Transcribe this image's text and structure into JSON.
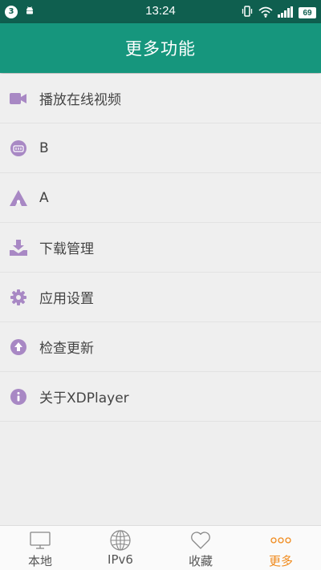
{
  "status_bar": {
    "notification_count": "3",
    "time": "13:24",
    "battery": "69",
    "icons": [
      "android-icon",
      "vibrate-icon",
      "wifi-icon",
      "signal-icon",
      "battery-icon"
    ]
  },
  "header": {
    "title": "更多功能"
  },
  "colors": {
    "accent": "#16967d",
    "status_bar": "#0f5f4f",
    "icon": "#a888c4",
    "active_tab": "#f08a1c"
  },
  "menu": {
    "items": [
      {
        "label": "播放在线视频",
        "icon": "video-camera-icon"
      },
      {
        "label": "B",
        "icon": "bilibili-icon"
      },
      {
        "label": "A",
        "icon": "acfun-icon"
      },
      {
        "label": "下载管理",
        "icon": "download-icon"
      },
      {
        "label": "应用设置",
        "icon": "gear-icon"
      },
      {
        "label": "检查更新",
        "icon": "upgrade-arrow-icon"
      },
      {
        "label": "关于XDPlayer",
        "icon": "info-icon"
      }
    ]
  },
  "bottom_nav": {
    "tabs": [
      {
        "label": "本地",
        "icon": "monitor-icon",
        "active": false
      },
      {
        "label": "IPv6",
        "icon": "globe-icon",
        "active": false
      },
      {
        "label": "收藏",
        "icon": "heart-icon",
        "active": false
      },
      {
        "label": "更多",
        "icon": "more-dots-icon",
        "active": true
      }
    ]
  }
}
